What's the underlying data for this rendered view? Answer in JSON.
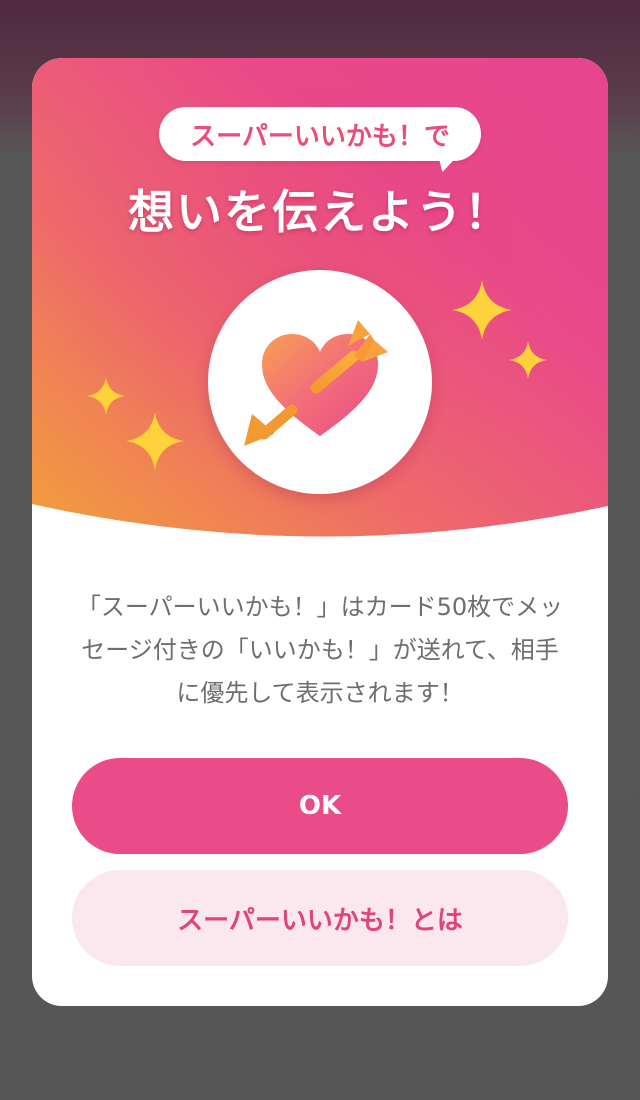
{
  "modal": {
    "bubble_text": "スーパーいいかも！で",
    "headline": "想いを伝えよう！",
    "description": "「スーパーいいかも！」はカード50枚でメッセージ付きの「いいかも！」が送れて、相手に優先して表示されます！",
    "hero_icon": "heart-arrow-icon",
    "ok_button": "OK",
    "info_button": "スーパーいいかも！とは"
  },
  "colors": {
    "primary_pink": "#ea4c87",
    "light_pink": "#fbe7ee",
    "gradient_orange": "#f2a03a",
    "gradient_magenta": "#e9488b",
    "sparkle_yellow": "#fdd23b",
    "text_gray": "#6e6e6e"
  }
}
